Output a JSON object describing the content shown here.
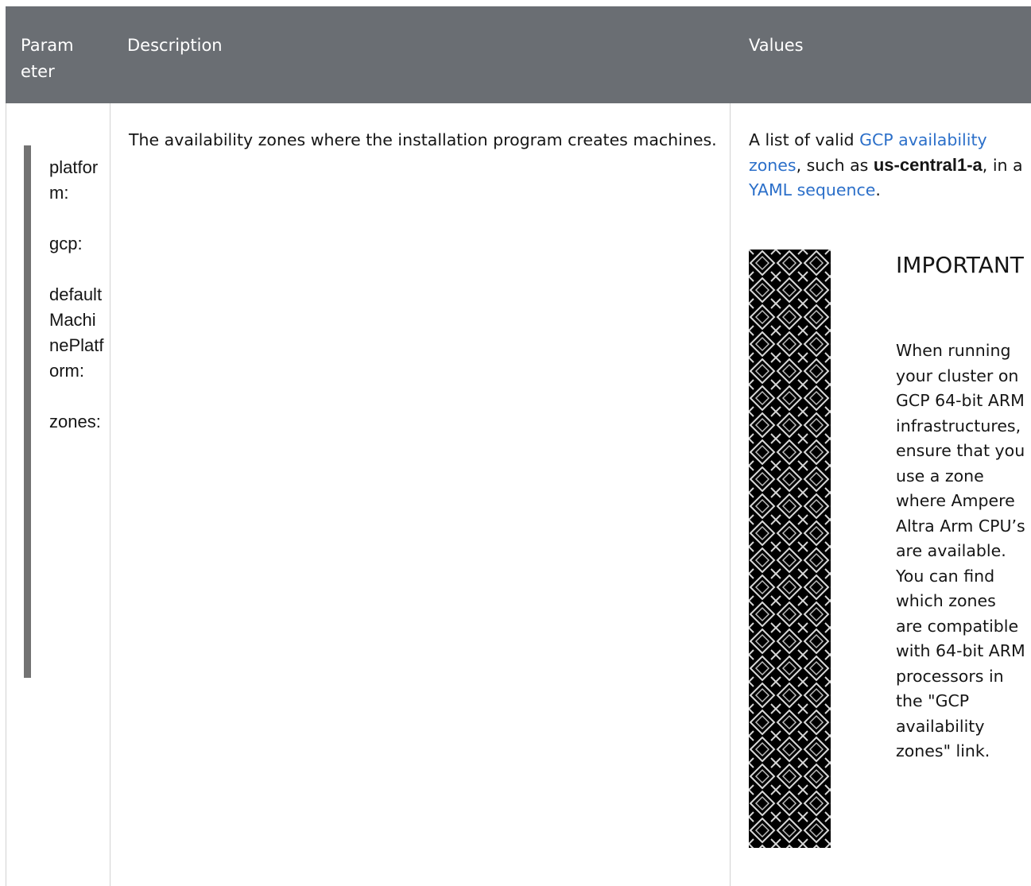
{
  "table": {
    "headers": {
      "parameter": "Param eter",
      "description": "Description",
      "values": "Values"
    },
    "row": {
      "parameter_segments": [
        "platform:",
        "gcp:",
        "defaultMachinePlatform:",
        "zones:"
      ],
      "description": "The availability zones where the installation program creates machines.",
      "values": {
        "prefix": "A list of valid ",
        "link1": "GCP availability zones",
        "middle": ", such as ",
        "code": "us-central1-a",
        "after_code": ", in a ",
        "link2": "YAML sequence",
        "suffix": "."
      },
      "admonition": {
        "title": "IMPORTANT",
        "body": "When running your cluster on GCP 64-bit ARM infrastructures, ensure that you use a zone where Ampere Altra Arm CPU’s are available. You can find which zones are compatible with 64-bit ARM processors in the \"GCP availability zones\" link."
      }
    }
  },
  "colors": {
    "header_bg": "#6a6e73",
    "link": "#2b6fc9",
    "code_bar": "#737373"
  }
}
